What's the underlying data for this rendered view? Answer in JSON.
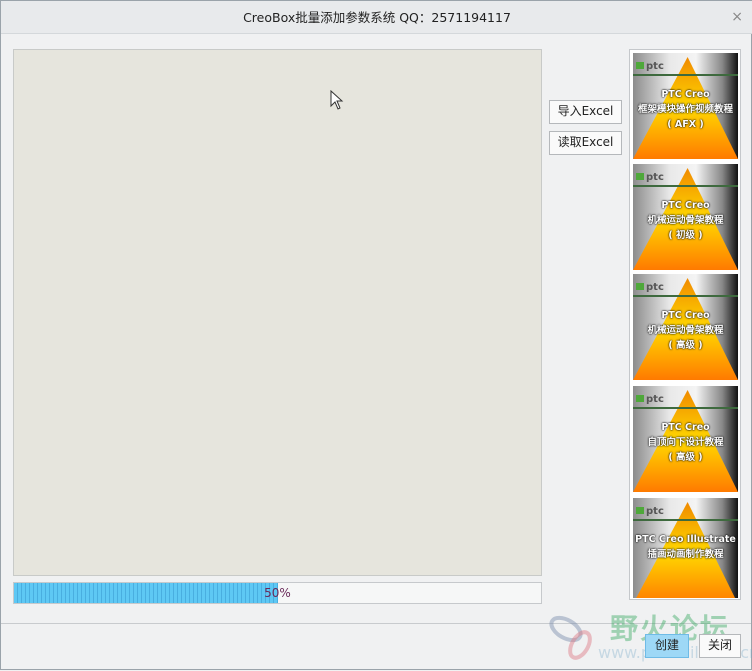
{
  "window": {
    "title": "CreoBox批量添加参数系统  QQ：2571194117",
    "close": "×"
  },
  "buttons": {
    "import_excel": "导入Excel",
    "read_excel": "读取Excel",
    "create": "创建",
    "close": "关闭"
  },
  "progress": {
    "value": 50,
    "label": "50%"
  },
  "banners": [
    {
      "brand": "ptc",
      "line1": "PTC Creo",
      "line2": "框架模块操作视频教程",
      "line3": "( AFX )"
    },
    {
      "brand": "ptc",
      "line1": "PTC Creo",
      "line2": "机械运动骨架教程",
      "line3": "( 初级 )"
    },
    {
      "brand": "ptc",
      "line1": "PTC Creo",
      "line2": "机械运动骨架教程",
      "line3": "( 高级 )"
    },
    {
      "brand": "ptc",
      "line1": "PTC Creo",
      "line2": "自顶向下设计教程",
      "line3": "( 高级 )"
    },
    {
      "brand": "ptc",
      "line1": "PTC Creo Illustrate",
      "line2": "插画动画制作教程",
      "line3": ""
    }
  ],
  "watermark": {
    "text": "野火论坛",
    "url": "www.proewildfire.cn"
  }
}
